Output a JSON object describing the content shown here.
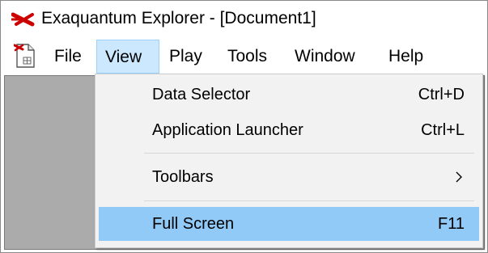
{
  "window": {
    "title": "Exaquantum Explorer - [Document1]",
    "logo_icon": "exaquantum-logo-icon",
    "accent_color": "#cc0000"
  },
  "menubar": {
    "doc_icon": "document-icon",
    "items": [
      {
        "label": "File"
      },
      {
        "label": "View"
      },
      {
        "label": "Play"
      },
      {
        "label": "Tools"
      },
      {
        "label": "Window"
      },
      {
        "label": "Help"
      }
    ],
    "active": "View"
  },
  "view_menu": {
    "items": [
      {
        "label": "Data Selector",
        "shortcut": "Ctrl+D"
      },
      {
        "label": "Application Launcher",
        "shortcut": "Ctrl+L"
      },
      {
        "label": "Toolbars",
        "shortcut": "",
        "submenu": true
      },
      {
        "label": "Full Screen",
        "shortcut": "F11"
      }
    ],
    "highlighted": "Full Screen",
    "highlight_color": "#91c9f7"
  }
}
